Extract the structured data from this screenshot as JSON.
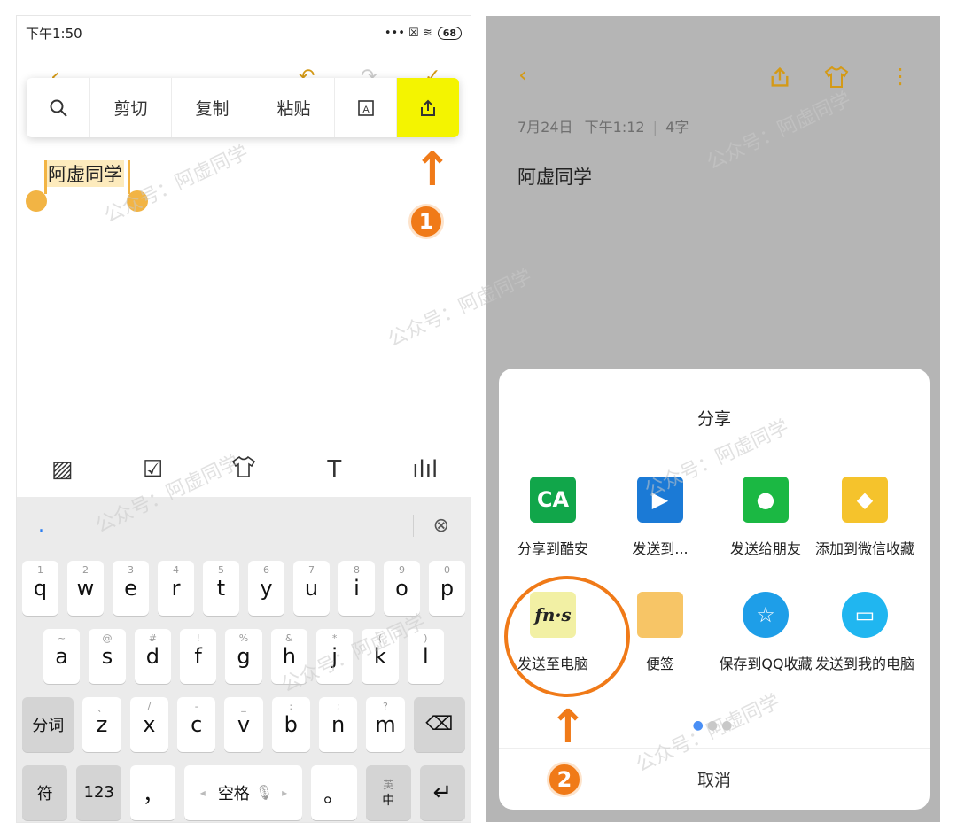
{
  "left": {
    "status": {
      "time": "下午1:50",
      "battery": "68",
      "icons": "••• ☒ ≋"
    },
    "popup": {
      "cut": "剪切",
      "copy": "复制",
      "paste": "粘贴"
    },
    "note_text": "阿虚同学",
    "step": "1",
    "keyboard": {
      "row1": [
        {
          "k": "q",
          "n": "1"
        },
        {
          "k": "w",
          "n": "2"
        },
        {
          "k": "e",
          "n": "3"
        },
        {
          "k": "r",
          "n": "4"
        },
        {
          "k": "t",
          "n": "5"
        },
        {
          "k": "y",
          "n": "6"
        },
        {
          "k": "u",
          "n": "7"
        },
        {
          "k": "i",
          "n": "8"
        },
        {
          "k": "o",
          "n": "9"
        },
        {
          "k": "p",
          "n": "0"
        }
      ],
      "row2": [
        {
          "k": "a",
          "n": "~"
        },
        {
          "k": "s",
          "n": "@"
        },
        {
          "k": "d",
          "n": "#"
        },
        {
          "k": "f",
          "n": "!"
        },
        {
          "k": "g",
          "n": "%"
        },
        {
          "k": "h",
          "n": "&"
        },
        {
          "k": "j",
          "n": "*"
        },
        {
          "k": "k",
          "n": "("
        },
        {
          "k": "l",
          "n": ")"
        }
      ],
      "row3": [
        {
          "k": "z",
          "n": "、"
        },
        {
          "k": "x",
          "n": "/"
        },
        {
          "k": "c",
          "n": "-"
        },
        {
          "k": "v",
          "n": "_"
        },
        {
          "k": "b",
          "n": ":"
        },
        {
          "k": "n",
          "n": ";"
        },
        {
          "k": "m",
          "n": "?"
        }
      ],
      "segment": "分词",
      "symbol": "符",
      "num": "123",
      "comma": "，",
      "space": "空格",
      "period": "。",
      "lang_top": "英",
      "lang_bot": "中"
    }
  },
  "right": {
    "meta": {
      "date": "7月24日",
      "time": "下午1:12",
      "count": "4字"
    },
    "title": "阿虚同学",
    "sheet": {
      "title": "分享",
      "apps": [
        {
          "label": "分享到酷安",
          "color": "#11a64a",
          "glyph": "CA"
        },
        {
          "label": "发送到...",
          "color": "#1b7ad6",
          "glyph": "▶"
        },
        {
          "label": "发送给朋友",
          "color": "#1bb843",
          "glyph": "●"
        },
        {
          "label": "添加到微信收藏",
          "color": "#f5c32c",
          "glyph": "◆"
        },
        {
          "label": "发送至电脑",
          "color": "#f2f0a4",
          "glyph": "fn·s"
        },
        {
          "label": "便签",
          "color": "#f7c566",
          "glyph": ""
        },
        {
          "label": "保存到QQ收藏",
          "color": "#1e9ee8",
          "glyph": "☆"
        },
        {
          "label": "发送到我的电脑",
          "color": "#20b6f0",
          "glyph": "▭"
        }
      ],
      "cancel": "取消"
    },
    "step": "2"
  },
  "watermark": "公众号：阿虚同学"
}
